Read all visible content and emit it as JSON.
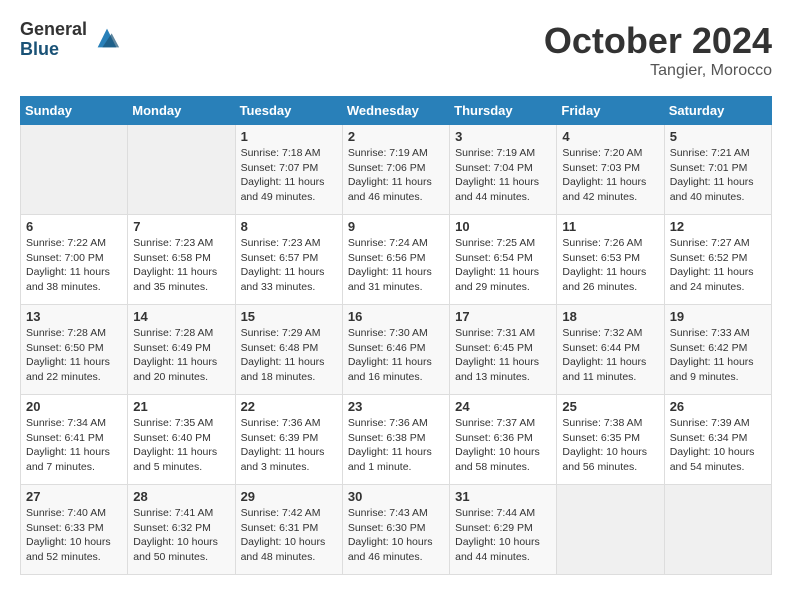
{
  "logo": {
    "general": "General",
    "blue": "Blue"
  },
  "title": {
    "month": "October 2024",
    "location": "Tangier, Morocco"
  },
  "headers": [
    "Sunday",
    "Monday",
    "Tuesday",
    "Wednesday",
    "Thursday",
    "Friday",
    "Saturday"
  ],
  "weeks": [
    [
      {
        "day": "",
        "info": ""
      },
      {
        "day": "",
        "info": ""
      },
      {
        "day": "1",
        "info": "Sunrise: 7:18 AM\nSunset: 7:07 PM\nDaylight: 11 hours\nand 49 minutes."
      },
      {
        "day": "2",
        "info": "Sunrise: 7:19 AM\nSunset: 7:06 PM\nDaylight: 11 hours\nand 46 minutes."
      },
      {
        "day": "3",
        "info": "Sunrise: 7:19 AM\nSunset: 7:04 PM\nDaylight: 11 hours\nand 44 minutes."
      },
      {
        "day": "4",
        "info": "Sunrise: 7:20 AM\nSunset: 7:03 PM\nDaylight: 11 hours\nand 42 minutes."
      },
      {
        "day": "5",
        "info": "Sunrise: 7:21 AM\nSunset: 7:01 PM\nDaylight: 11 hours\nand 40 minutes."
      }
    ],
    [
      {
        "day": "6",
        "info": "Sunrise: 7:22 AM\nSunset: 7:00 PM\nDaylight: 11 hours\nand 38 minutes."
      },
      {
        "day": "7",
        "info": "Sunrise: 7:23 AM\nSunset: 6:58 PM\nDaylight: 11 hours\nand 35 minutes."
      },
      {
        "day": "8",
        "info": "Sunrise: 7:23 AM\nSunset: 6:57 PM\nDaylight: 11 hours\nand 33 minutes."
      },
      {
        "day": "9",
        "info": "Sunrise: 7:24 AM\nSunset: 6:56 PM\nDaylight: 11 hours\nand 31 minutes."
      },
      {
        "day": "10",
        "info": "Sunrise: 7:25 AM\nSunset: 6:54 PM\nDaylight: 11 hours\nand 29 minutes."
      },
      {
        "day": "11",
        "info": "Sunrise: 7:26 AM\nSunset: 6:53 PM\nDaylight: 11 hours\nand 26 minutes."
      },
      {
        "day": "12",
        "info": "Sunrise: 7:27 AM\nSunset: 6:52 PM\nDaylight: 11 hours\nand 24 minutes."
      }
    ],
    [
      {
        "day": "13",
        "info": "Sunrise: 7:28 AM\nSunset: 6:50 PM\nDaylight: 11 hours\nand 22 minutes."
      },
      {
        "day": "14",
        "info": "Sunrise: 7:28 AM\nSunset: 6:49 PM\nDaylight: 11 hours\nand 20 minutes."
      },
      {
        "day": "15",
        "info": "Sunrise: 7:29 AM\nSunset: 6:48 PM\nDaylight: 11 hours\nand 18 minutes."
      },
      {
        "day": "16",
        "info": "Sunrise: 7:30 AM\nSunset: 6:46 PM\nDaylight: 11 hours\nand 16 minutes."
      },
      {
        "day": "17",
        "info": "Sunrise: 7:31 AM\nSunset: 6:45 PM\nDaylight: 11 hours\nand 13 minutes."
      },
      {
        "day": "18",
        "info": "Sunrise: 7:32 AM\nSunset: 6:44 PM\nDaylight: 11 hours\nand 11 minutes."
      },
      {
        "day": "19",
        "info": "Sunrise: 7:33 AM\nSunset: 6:42 PM\nDaylight: 11 hours\nand 9 minutes."
      }
    ],
    [
      {
        "day": "20",
        "info": "Sunrise: 7:34 AM\nSunset: 6:41 PM\nDaylight: 11 hours\nand 7 minutes."
      },
      {
        "day": "21",
        "info": "Sunrise: 7:35 AM\nSunset: 6:40 PM\nDaylight: 11 hours\nand 5 minutes."
      },
      {
        "day": "22",
        "info": "Sunrise: 7:36 AM\nSunset: 6:39 PM\nDaylight: 11 hours\nand 3 minutes."
      },
      {
        "day": "23",
        "info": "Sunrise: 7:36 AM\nSunset: 6:38 PM\nDaylight: 11 hours\nand 1 minute."
      },
      {
        "day": "24",
        "info": "Sunrise: 7:37 AM\nSunset: 6:36 PM\nDaylight: 10 hours\nand 58 minutes."
      },
      {
        "day": "25",
        "info": "Sunrise: 7:38 AM\nSunset: 6:35 PM\nDaylight: 10 hours\nand 56 minutes."
      },
      {
        "day": "26",
        "info": "Sunrise: 7:39 AM\nSunset: 6:34 PM\nDaylight: 10 hours\nand 54 minutes."
      }
    ],
    [
      {
        "day": "27",
        "info": "Sunrise: 7:40 AM\nSunset: 6:33 PM\nDaylight: 10 hours\nand 52 minutes."
      },
      {
        "day": "28",
        "info": "Sunrise: 7:41 AM\nSunset: 6:32 PM\nDaylight: 10 hours\nand 50 minutes."
      },
      {
        "day": "29",
        "info": "Sunrise: 7:42 AM\nSunset: 6:31 PM\nDaylight: 10 hours\nand 48 minutes."
      },
      {
        "day": "30",
        "info": "Sunrise: 7:43 AM\nSunset: 6:30 PM\nDaylight: 10 hours\nand 46 minutes."
      },
      {
        "day": "31",
        "info": "Sunrise: 7:44 AM\nSunset: 6:29 PM\nDaylight: 10 hours\nand 44 minutes."
      },
      {
        "day": "",
        "info": ""
      },
      {
        "day": "",
        "info": ""
      }
    ]
  ]
}
